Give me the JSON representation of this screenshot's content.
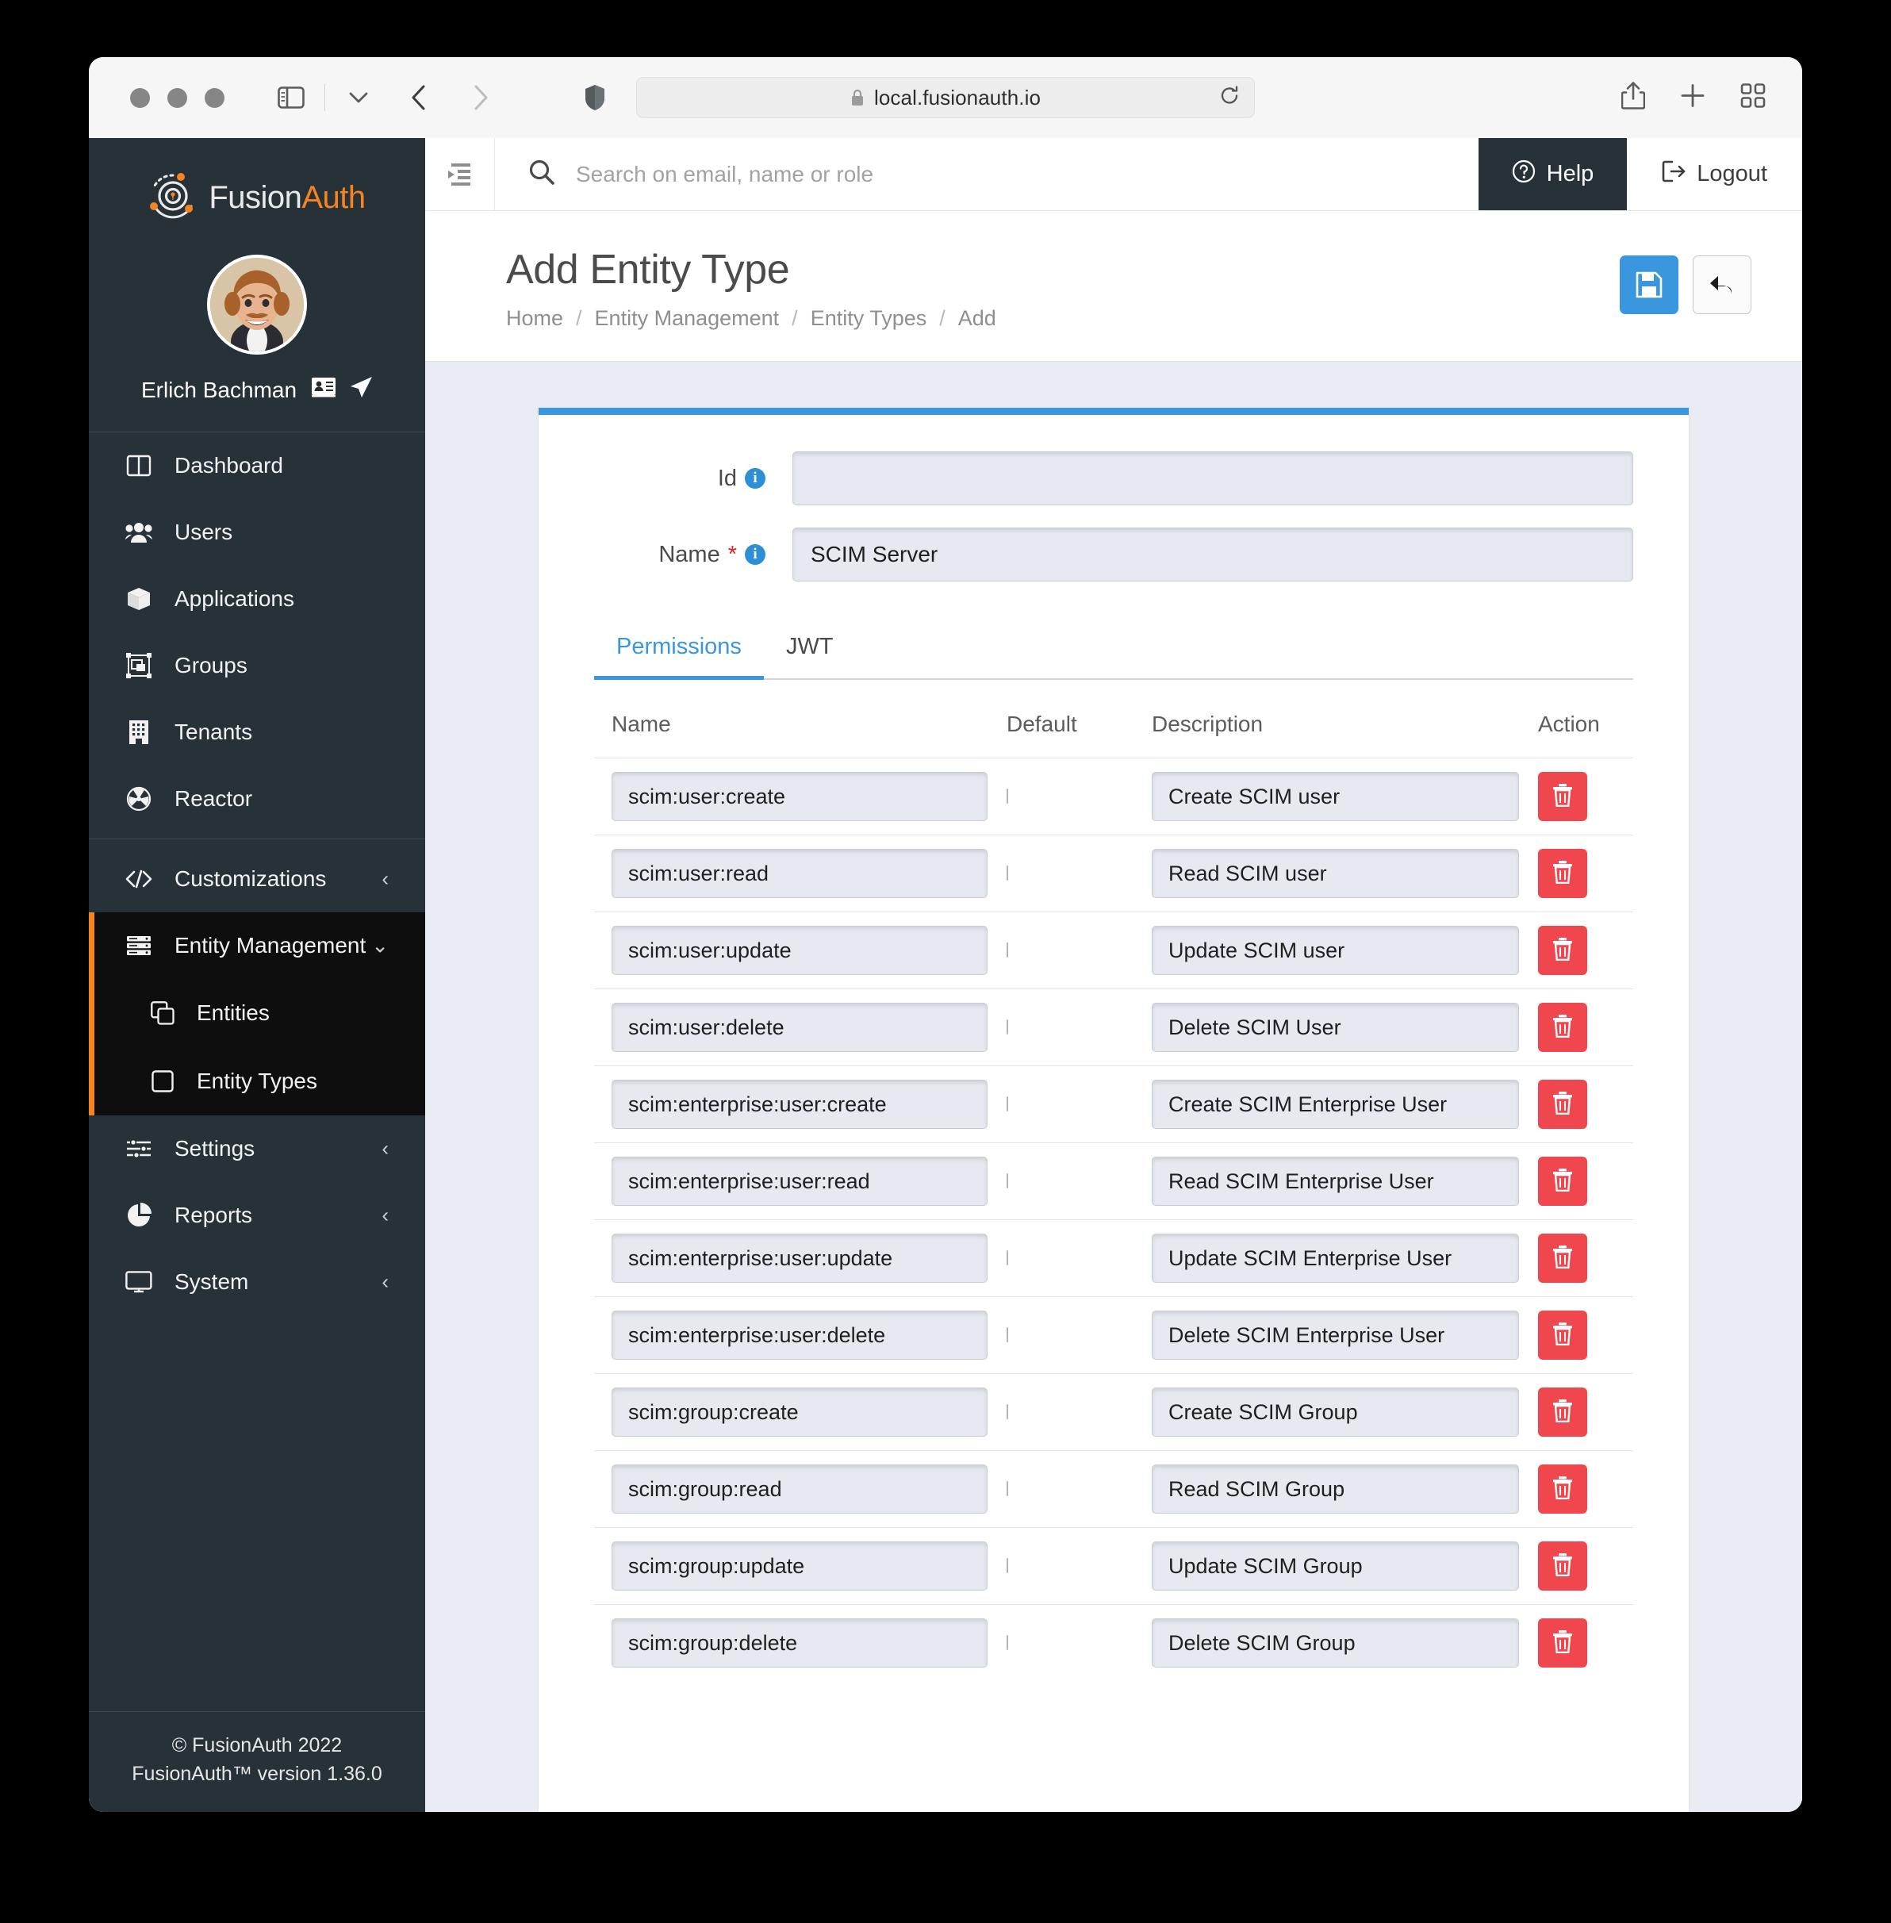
{
  "browser": {
    "url": "local.fusionauth.io",
    "lock_icon": "lock-icon",
    "shield_icon": "shield-icon",
    "sidebar_icon": "sidebar-toggle-icon",
    "back_icon": "back-chevron-icon",
    "forward_icon": "forward-chevron-icon",
    "reload_icon": "reload-icon",
    "share_icon": "share-icon",
    "newtab_icon": "plus-icon",
    "tabs_icon": "tab-overview-icon"
  },
  "sidebar": {
    "brand": {
      "first": "Fusion",
      "second": "Auth",
      "logo_icon": "fusionauth-logo-icon"
    },
    "user": {
      "name": "Erlich Bachman",
      "card_icon": "id-card-icon",
      "send_icon": "paper-plane-icon"
    },
    "items": [
      {
        "label": "Dashboard",
        "icon": "dashboard-icon"
      },
      {
        "label": "Users",
        "icon": "users-icon"
      },
      {
        "label": "Applications",
        "icon": "box-icon"
      },
      {
        "label": "Groups",
        "icon": "groups-icon"
      },
      {
        "label": "Tenants",
        "icon": "building-icon"
      },
      {
        "label": "Reactor",
        "icon": "reactor-icon"
      }
    ],
    "customizations": {
      "label": "Customizations",
      "icon": "code-icon",
      "chevron": "‹"
    },
    "entity_management": {
      "label": "Entity Management",
      "icon": "server-icon",
      "chevron": "⌄"
    },
    "entity_sub": [
      {
        "label": "Entities",
        "icon": "copy-icon"
      },
      {
        "label": "Entity Types",
        "icon": "square-icon"
      }
    ],
    "items_after": [
      {
        "label": "Settings",
        "icon": "sliders-icon",
        "chevron": "‹"
      },
      {
        "label": "Reports",
        "icon": "pie-chart-icon",
        "chevron": "‹"
      },
      {
        "label": "System",
        "icon": "monitor-icon",
        "chevron": "‹"
      }
    ],
    "footer_line1": "© FusionAuth 2022",
    "footer_line2": "FusionAuth™ version 1.36.0"
  },
  "topbar": {
    "collapse_icon": "collapse-sidebar-icon",
    "search_icon": "search-icon",
    "search_placeholder": "Search on email, name or role",
    "search_value": "",
    "help_label": "Help",
    "help_icon": "question-circle-icon",
    "logout_label": "Logout",
    "logout_icon": "logout-icon"
  },
  "page": {
    "title": "Add Entity Type",
    "breadcrumbs": [
      "Home",
      "Entity Management",
      "Entity Types",
      "Add"
    ],
    "separator": "/",
    "save_icon": "floppy-save-icon",
    "back_icon": "undo-arrow-icon",
    "accent_color": "#3a97dd"
  },
  "form": {
    "id_label": "Id",
    "id_value": "",
    "name_label": "Name",
    "name_required": "*",
    "name_value": "SCIM Server"
  },
  "tabs": [
    {
      "label": "Permissions",
      "active": true
    },
    {
      "label": "JWT",
      "active": false
    }
  ],
  "table": {
    "headers": {
      "name": "Name",
      "default": "Default",
      "description": "Description",
      "action": "Action"
    },
    "delete_icon": "trash-icon",
    "rows": [
      {
        "name": "scim:user:create",
        "default": false,
        "description": "Create SCIM user"
      },
      {
        "name": "scim:user:read",
        "default": false,
        "description": "Read SCIM user"
      },
      {
        "name": "scim:user:update",
        "default": false,
        "description": "Update SCIM user"
      },
      {
        "name": "scim:user:delete",
        "default": false,
        "description": "Delete SCIM User"
      },
      {
        "name": "scim:enterprise:user:create",
        "default": false,
        "description": "Create SCIM Enterprise User"
      },
      {
        "name": "scim:enterprise:user:read",
        "default": false,
        "description": "Read SCIM Enterprise User"
      },
      {
        "name": "scim:enterprise:user:update",
        "default": false,
        "description": "Update SCIM Enterprise User"
      },
      {
        "name": "scim:enterprise:user:delete",
        "default": false,
        "description": "Delete SCIM Enterprise User"
      },
      {
        "name": "scim:group:create",
        "default": false,
        "description": "Create SCIM Group"
      },
      {
        "name": "scim:group:read",
        "default": false,
        "description": "Read SCIM Group"
      },
      {
        "name": "scim:group:update",
        "default": false,
        "description": "Update SCIM Group"
      },
      {
        "name": "scim:group:delete",
        "default": false,
        "description": "Delete SCIM Group"
      }
    ]
  }
}
